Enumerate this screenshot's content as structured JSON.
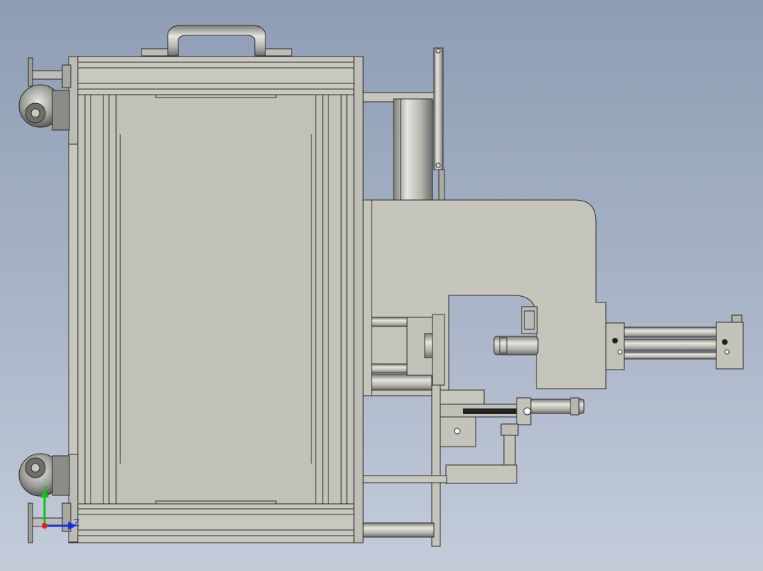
{
  "viewport": {
    "background_top": "#8e9db5",
    "background_bottom": "#c4ccda",
    "part_color": "#c6c5bc",
    "edge_color": "#2a2a2a"
  },
  "triad": {
    "y_label": "Y",
    "z_label": "Z",
    "y_color": "#10c010",
    "z_color": "#1a2ee0",
    "origin_color": "#e02020"
  }
}
